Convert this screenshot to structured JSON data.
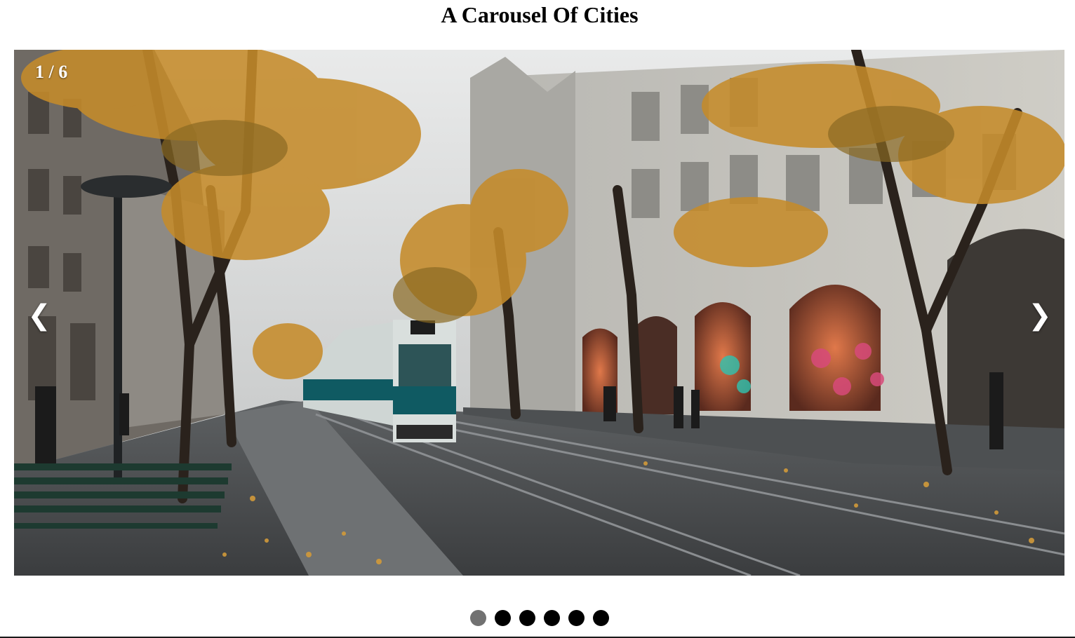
{
  "title": "A Carousel Of Cities",
  "carousel": {
    "counter": "1 / 6",
    "current_slide": 1,
    "total_slides": 6,
    "prev_label": "❮",
    "next_label": "❯",
    "image_alt": "",
    "active_dot_color": "#717171",
    "dot_color": "#000000"
  }
}
